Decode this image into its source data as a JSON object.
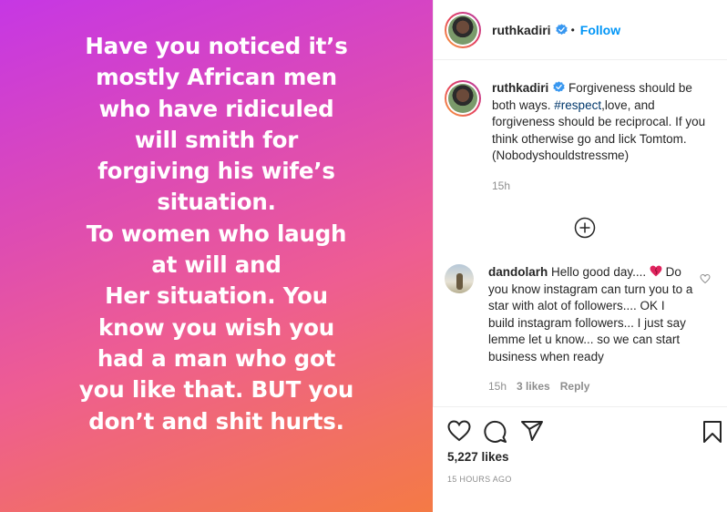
{
  "media": {
    "lines": [
      "Have you noticed it’s",
      "mostly African men",
      "who have ridiculed",
      "will smith for",
      "forgiving his wife’s",
      "situation.",
      "To women who laugh",
      "at will and",
      "Her situation. You",
      "know you wish you",
      "had a man who got",
      "you like that. BUT you",
      "don’t and shit hurts."
    ]
  },
  "header": {
    "username": "ruthkadiri",
    "separator": "•",
    "follow_label": "Follow"
  },
  "caption": {
    "username": "ruthkadiri",
    "text_before": " Forgiveness should be both ways. ",
    "hashtag": "#respect",
    "text_after": ",love, and forgiveness should be reciprocal. If you think otherwise go and lick Tomtom. (Nobodyshouldstressme)",
    "time": "15h"
  },
  "comment": {
    "username": "dandolarh",
    "text_before": " Hello good day.... ",
    "text_after": " Do you know instagram can turn you to a star with alot of followers.... OK I build instagram followers... I just say lemme let u know... so we can start business when ready",
    "time": "15h",
    "likes": "3 likes",
    "reply": "Reply"
  },
  "actions": {
    "likes": "5,227 likes",
    "time_ago": "15 HOURS AGO"
  },
  "colors": {
    "link": "#0095f6",
    "hashtag": "#00376b",
    "muted": "#8e8e8e"
  },
  "icons": [
    "verified-badge-icon",
    "add-comments-icon",
    "heart-icon",
    "comment-icon",
    "share-icon",
    "bookmark-icon",
    "red-heart-emoji-icon"
  ]
}
